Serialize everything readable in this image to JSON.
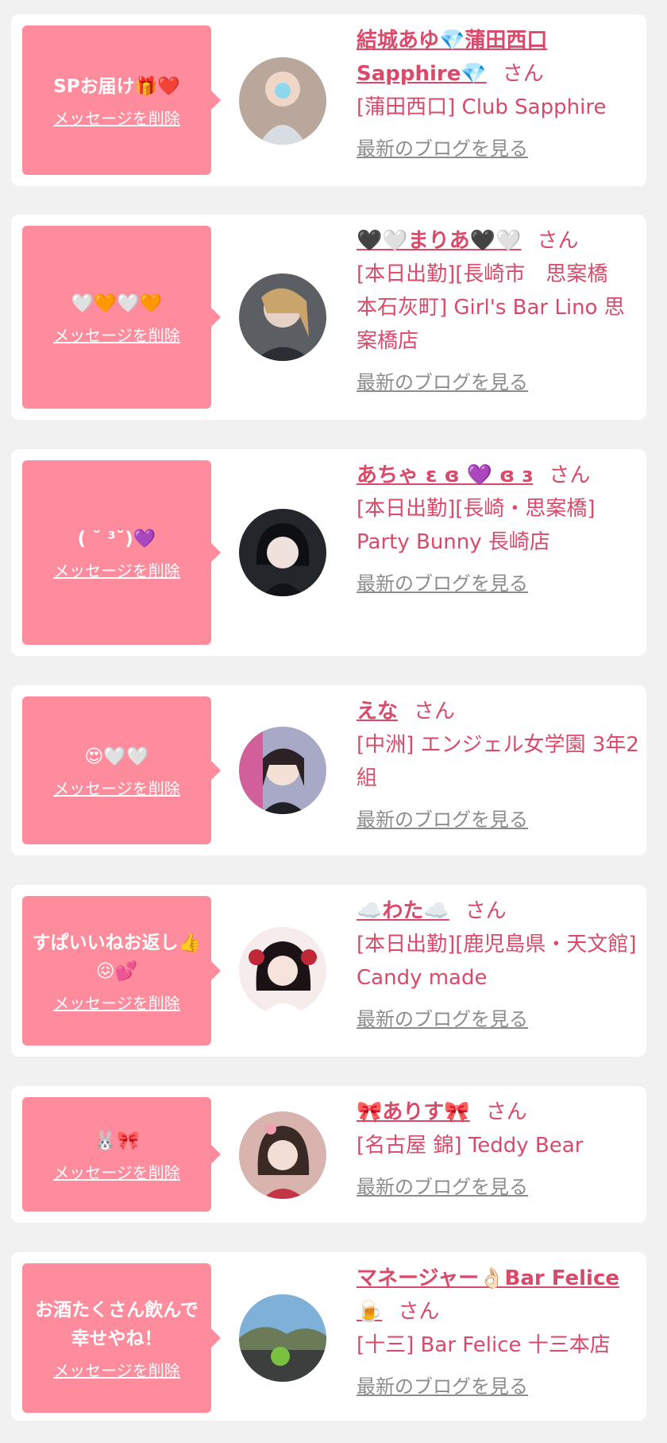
{
  "colors": {
    "page_bg": "#f1f1f1",
    "card_bg": "#ffffff",
    "bubble": "#fe8c9c",
    "name": "#d94a6a",
    "blog_link": "#8c8c8c"
  },
  "delete_label": "メッセージを削除",
  "blog_label": "最新のブログを見る",
  "items": [
    {
      "message": "SPお届け🎁❤️",
      "name": "結城あゆ💎蒲田西口Sapphire💎",
      "honorific": "さん",
      "shop": "[蒲田西口] Club Sapphire",
      "avatar_icon": "avatar-photo"
    },
    {
      "message": "🤍🧡🤍🧡",
      "name": "🖤🤍まりあ🖤🤍",
      "honorific": "さん",
      "shop": "[本日出勤][長崎市　思案橋　本石灰町] Girl's Bar Lino 思案橋店",
      "avatar_icon": "avatar-photo"
    },
    {
      "message": "( ˘ ³˘)💜",
      "name": "あちゃ ɛ ɞ 💜 ɞ ɜ",
      "honorific": "さん",
      "shop": "[本日出勤][長崎・思案橋] Party Bunny 長崎店",
      "avatar_icon": "avatar-photo"
    },
    {
      "message": "😍🤍🤍",
      "name": "えな",
      "honorific": "さん",
      "shop": "[中洲] エンジェル女学園 3年2組",
      "avatar_icon": "avatar-photo"
    },
    {
      "message": "すぱいいねお返し👍😖💕",
      "name": "☁️わた☁️",
      "honorific": "さん",
      "shop": "[本日出勤][鹿児島県・天文館] Candy made",
      "avatar_icon": "avatar-photo"
    },
    {
      "message": "🐰🎀",
      "name": "🎀ありす🎀",
      "honorific": "さん",
      "shop": "[名古屋 錦] Teddy Bear",
      "avatar_icon": "avatar-photo"
    },
    {
      "message": "お酒たくさん飲んで幸せやね！",
      "name": "マネージャー👌🏻Bar Felice🍺",
      "honorific": "さん",
      "shop": "[十三] Bar Felice 十三本店",
      "avatar_icon": "avatar-photo"
    }
  ]
}
